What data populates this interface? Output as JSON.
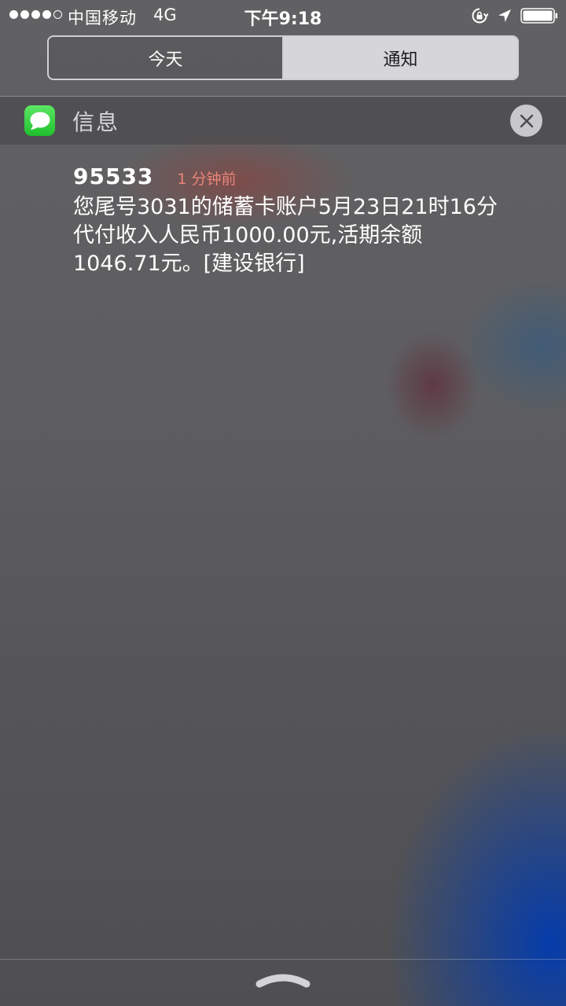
{
  "status_bar": {
    "carrier": "中国移动",
    "network": "4G",
    "time": "下午9:18",
    "signal_bars_filled": 4,
    "signal_bars_total": 5,
    "battery_level": 1.0
  },
  "tabs": [
    {
      "label": "今天",
      "selected": false
    },
    {
      "label": "通知",
      "selected": true
    }
  ],
  "notification_group": {
    "app_name": "信息",
    "app_icon": "messages-icon",
    "close_icon": "close-icon"
  },
  "notification": {
    "sender": "95533",
    "time_ago": "1 分钟前",
    "body_lines": [
      "您尾号3031的储蓄卡账户5月23日21时16分",
      "代付收入人民币1000.00元,活期余额",
      "1046.71元。[建设银行]"
    ]
  },
  "colors": {
    "time_ago": "#e8857a",
    "messages_green": "#1fbf2c",
    "selected_tab_bg": "#d6d6d8"
  },
  "icons": [
    "lock-rotation-icon",
    "location-arrow-icon",
    "battery-icon",
    "grabber-chevron-icon"
  ]
}
